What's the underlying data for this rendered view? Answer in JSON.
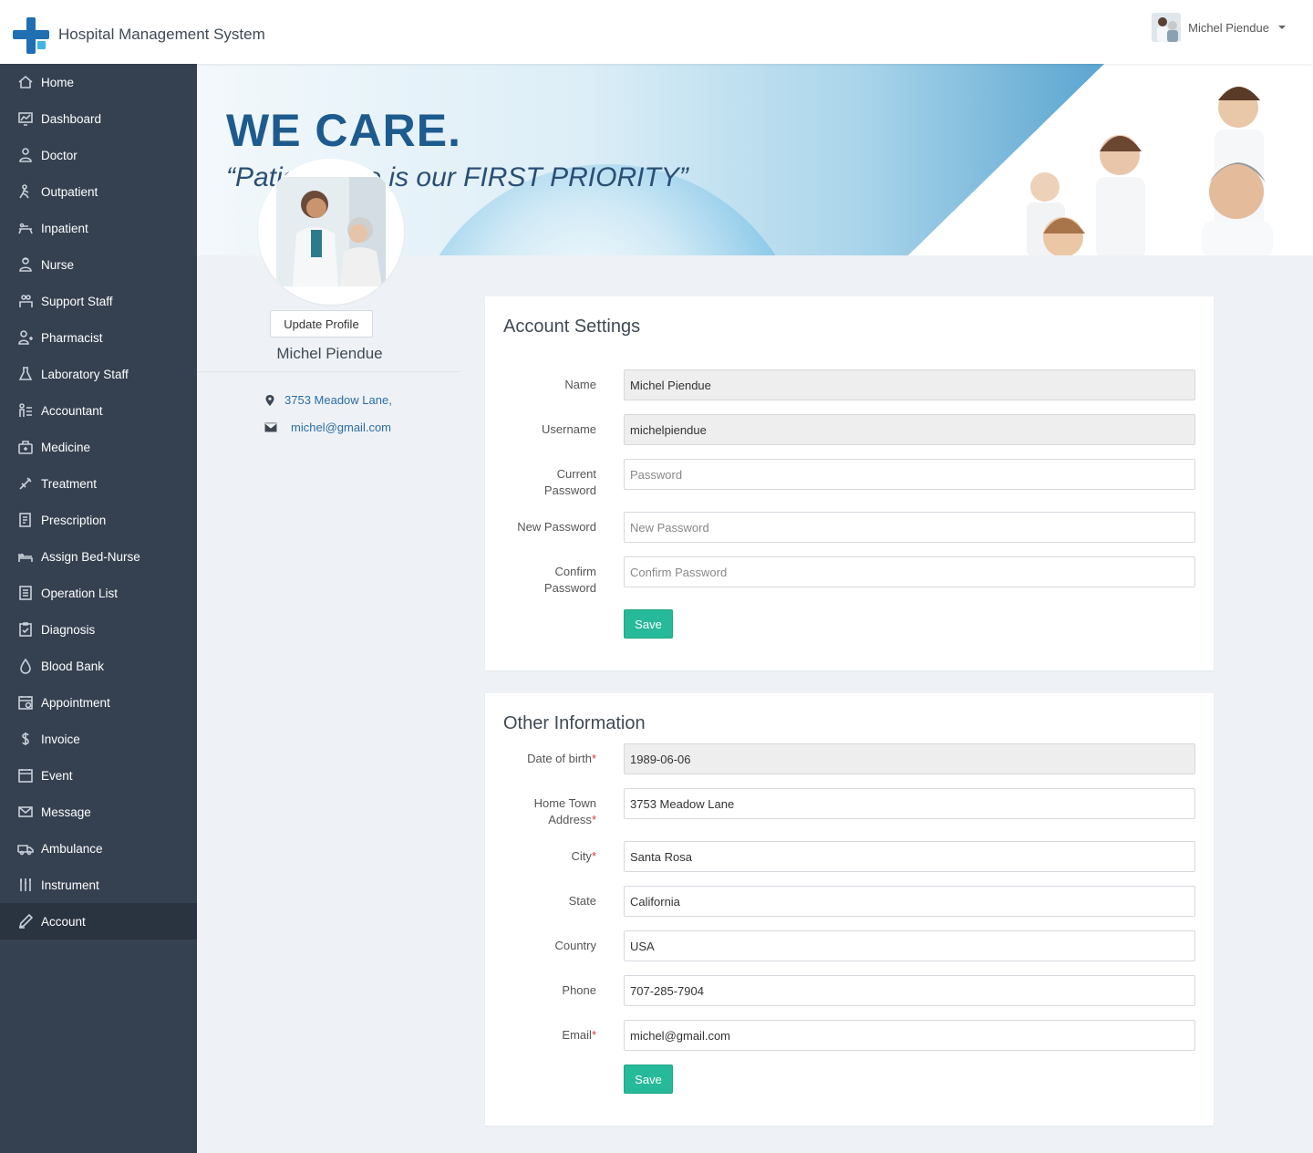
{
  "header": {
    "app_title": "Hospital Management System",
    "user_name": "Michel Piendue"
  },
  "sidebar": {
    "items": [
      {
        "label": "Home",
        "icon": "home-icon"
      },
      {
        "label": "Dashboard",
        "icon": "dashboard-icon"
      },
      {
        "label": "Doctor",
        "icon": "doctor-icon"
      },
      {
        "label": "Outpatient",
        "icon": "outpatient-icon"
      },
      {
        "label": "Inpatient",
        "icon": "inpatient-icon"
      },
      {
        "label": "Nurse",
        "icon": "nurse-icon"
      },
      {
        "label": "Support Staff",
        "icon": "support-staff-icon"
      },
      {
        "label": "Pharmacist",
        "icon": "pharmacist-icon"
      },
      {
        "label": "Laboratory Staff",
        "icon": "flask-icon"
      },
      {
        "label": "Accountant",
        "icon": "accountant-icon"
      },
      {
        "label": "Medicine",
        "icon": "medicine-icon"
      },
      {
        "label": "Treatment",
        "icon": "treatment-icon"
      },
      {
        "label": "Prescription",
        "icon": "prescription-icon"
      },
      {
        "label": "Assign Bed-Nurse",
        "icon": "bed-icon"
      },
      {
        "label": "Operation List",
        "icon": "operation-list-icon"
      },
      {
        "label": "Diagnosis",
        "icon": "diagnosis-icon"
      },
      {
        "label": "Blood Bank",
        "icon": "blood-drop-icon"
      },
      {
        "label": "Appointment",
        "icon": "appointment-icon"
      },
      {
        "label": "Invoice",
        "icon": "dollar-icon"
      },
      {
        "label": "Event",
        "icon": "calendar-icon"
      },
      {
        "label": "Message",
        "icon": "envelope-icon"
      },
      {
        "label": "Ambulance",
        "icon": "ambulance-icon"
      },
      {
        "label": "Instrument",
        "icon": "instrument-icon"
      },
      {
        "label": "Account",
        "icon": "pencil-icon"
      }
    ],
    "active": "Account"
  },
  "banner": {
    "title": "WE CARE.",
    "subtitle": "“Patient care is our FIRST PRIORITY”"
  },
  "profile": {
    "update_button": "Update Profile",
    "name": "Michel Piendue",
    "address": "3753 Meadow Lane,",
    "email": "michel@gmail.com"
  },
  "account_settings": {
    "title": "Account Settings",
    "name_label": "Name",
    "name_value": "Michel Piendue",
    "username_label": "Username",
    "username_value": "michelpiendue",
    "current_password_label_1": "Current",
    "current_password_label_2": "Password",
    "current_password_placeholder": "Password",
    "new_password_label": "New Password",
    "new_password_placeholder": "New Password",
    "confirm_password_label_1": "Confirm",
    "confirm_password_label_2": "Password",
    "confirm_password_placeholder": "Confirm Password",
    "save_label": "Save"
  },
  "other_information": {
    "title": "Other Information",
    "dob_label": "Date of birth",
    "dob_value": "1989-06-06",
    "hometown_label_1": "Home Town",
    "hometown_label_2": "Address",
    "hometown_value": "3753 Meadow Lane",
    "city_label": "City",
    "city_value": "Santa Rosa",
    "state_label": "State",
    "state_value": "California",
    "country_label": "Country",
    "country_value": "USA",
    "phone_label": "Phone",
    "phone_value": "707-285-7904",
    "email_label": "Email",
    "email_value": "michel@gmail.com",
    "required_mark": "*",
    "save_label": "Save"
  },
  "colors": {
    "sidebar_bg": "#354050",
    "sidebar_active": "#2a3340",
    "save_button": "#26b99a",
    "link": "#2d6da3",
    "required": "#d9363e"
  }
}
